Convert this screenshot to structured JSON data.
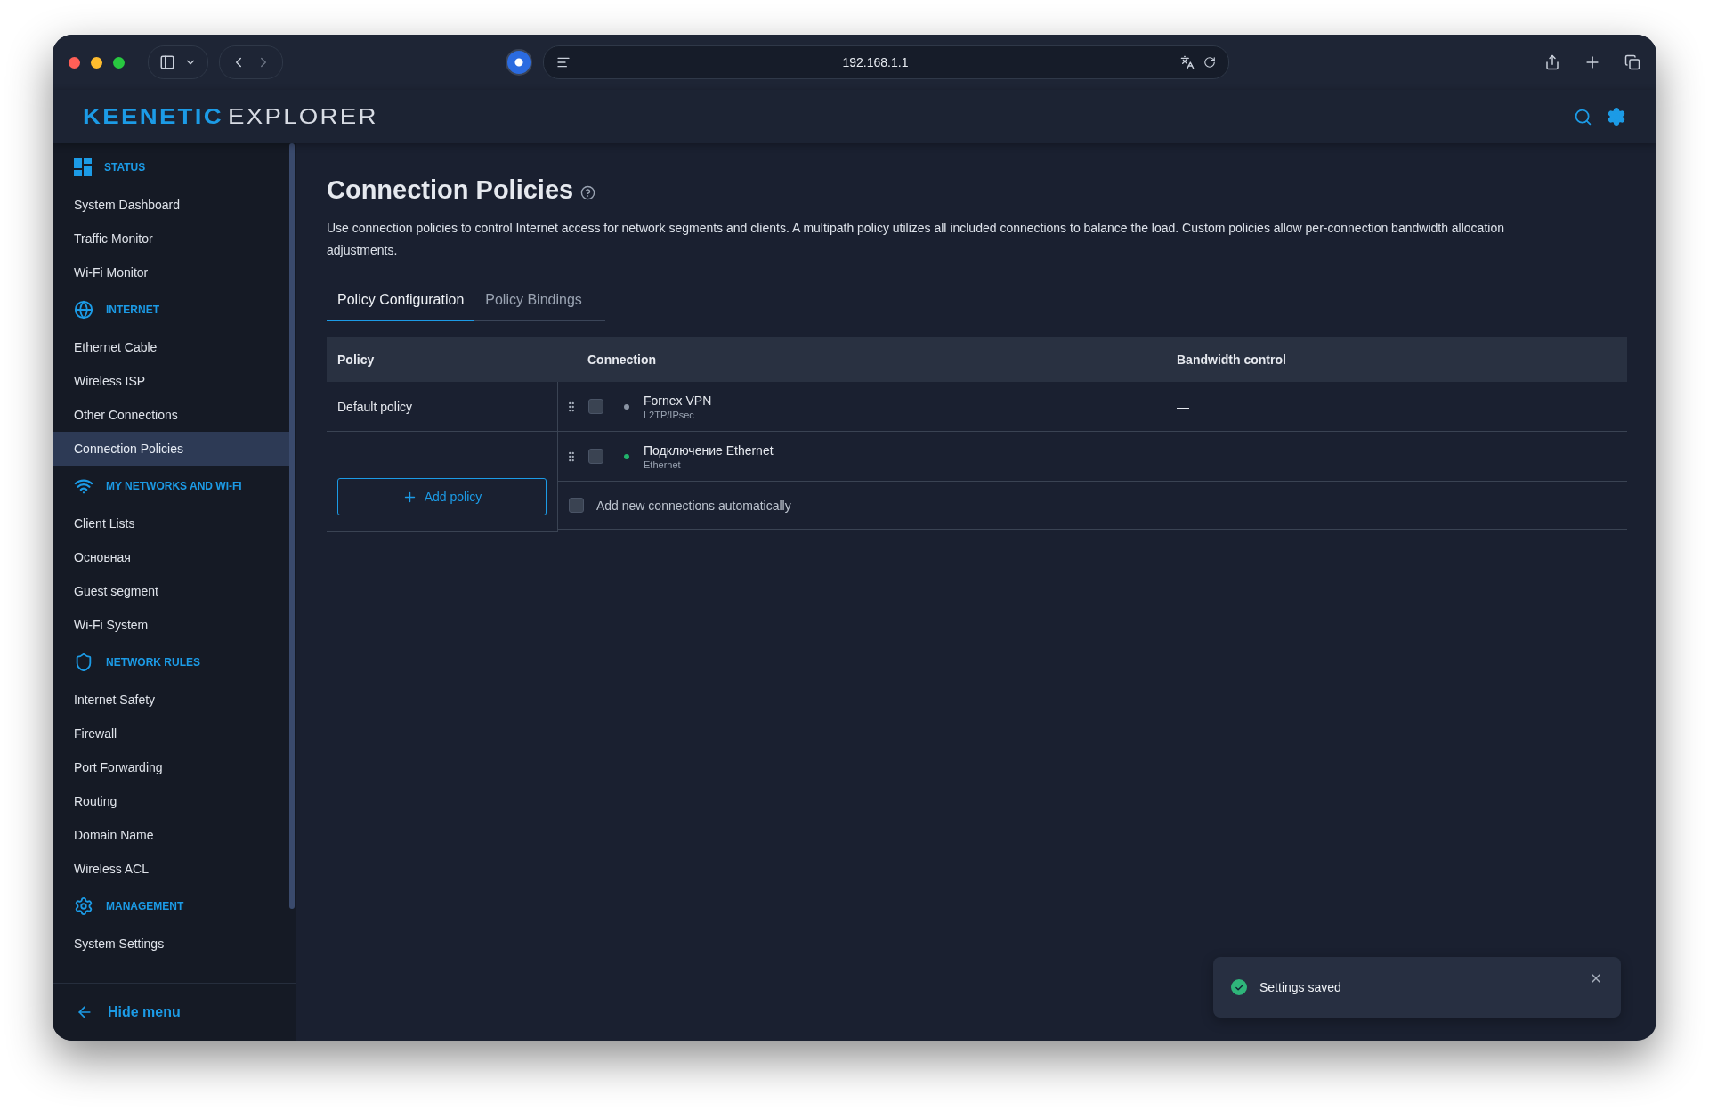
{
  "browser": {
    "address": "192.168.1.1"
  },
  "header": {
    "logo_primary": "KEENETIC",
    "logo_secondary": "EXPLORER"
  },
  "sidebar": {
    "sections": [
      {
        "title": "STATUS",
        "items": [
          {
            "label": "System Dashboard",
            "selected": false
          },
          {
            "label": "Traffic Monitor",
            "selected": false
          },
          {
            "label": "Wi-Fi Monitor",
            "selected": false
          }
        ]
      },
      {
        "title": "INTERNET",
        "items": [
          {
            "label": "Ethernet Cable",
            "selected": false
          },
          {
            "label": "Wireless ISP",
            "selected": false
          },
          {
            "label": "Other Connections",
            "selected": false
          },
          {
            "label": "Connection Policies",
            "selected": true
          }
        ]
      },
      {
        "title": "MY NETWORKS AND WI-FI",
        "items": [
          {
            "label": "Client Lists",
            "selected": false
          },
          {
            "label": "Основная",
            "selected": false
          },
          {
            "label": "Guest segment",
            "selected": false
          },
          {
            "label": "Wi-Fi System",
            "selected": false
          }
        ]
      },
      {
        "title": "NETWORK RULES",
        "items": [
          {
            "label": "Internet Safety",
            "selected": false
          },
          {
            "label": "Firewall",
            "selected": false
          },
          {
            "label": "Port Forwarding",
            "selected": false
          },
          {
            "label": "Routing",
            "selected": false
          },
          {
            "label": "Domain Name",
            "selected": false
          },
          {
            "label": "Wireless ACL",
            "selected": false
          }
        ]
      },
      {
        "title": "MANAGEMENT",
        "items": [
          {
            "label": "System Settings",
            "selected": false
          }
        ]
      }
    ],
    "hide_menu": "Hide menu"
  },
  "page": {
    "title": "Connection Policies",
    "description": "Use connection policies to control Internet access for network segments and clients. A multipath policy utilizes all included connections to balance the load. Custom policies allow per-connection bandwidth allocation adjustments.",
    "tabs": [
      {
        "label": "Policy Configuration",
        "selected": true
      },
      {
        "label": "Policy Bindings",
        "selected": false
      }
    ],
    "table": {
      "columns": [
        "Policy",
        "Connection",
        "Bandwidth control"
      ],
      "policies": [
        {
          "name": "Default policy"
        }
      ],
      "add_policy": "Add policy",
      "connections": [
        {
          "name": "Fornex VPN",
          "type": "L2TP/IPsec",
          "checked": false,
          "color": "#8a93a3",
          "bandwidth": "—"
        },
        {
          "name": "Подключение Ethernet",
          "type": "Ethernet",
          "checked": false,
          "color": "#21b26b",
          "bandwidth": "—"
        }
      ],
      "auto_add": {
        "label": "Add new connections automatically",
        "checked": false
      }
    }
  },
  "toast": {
    "message": "Settings saved"
  }
}
